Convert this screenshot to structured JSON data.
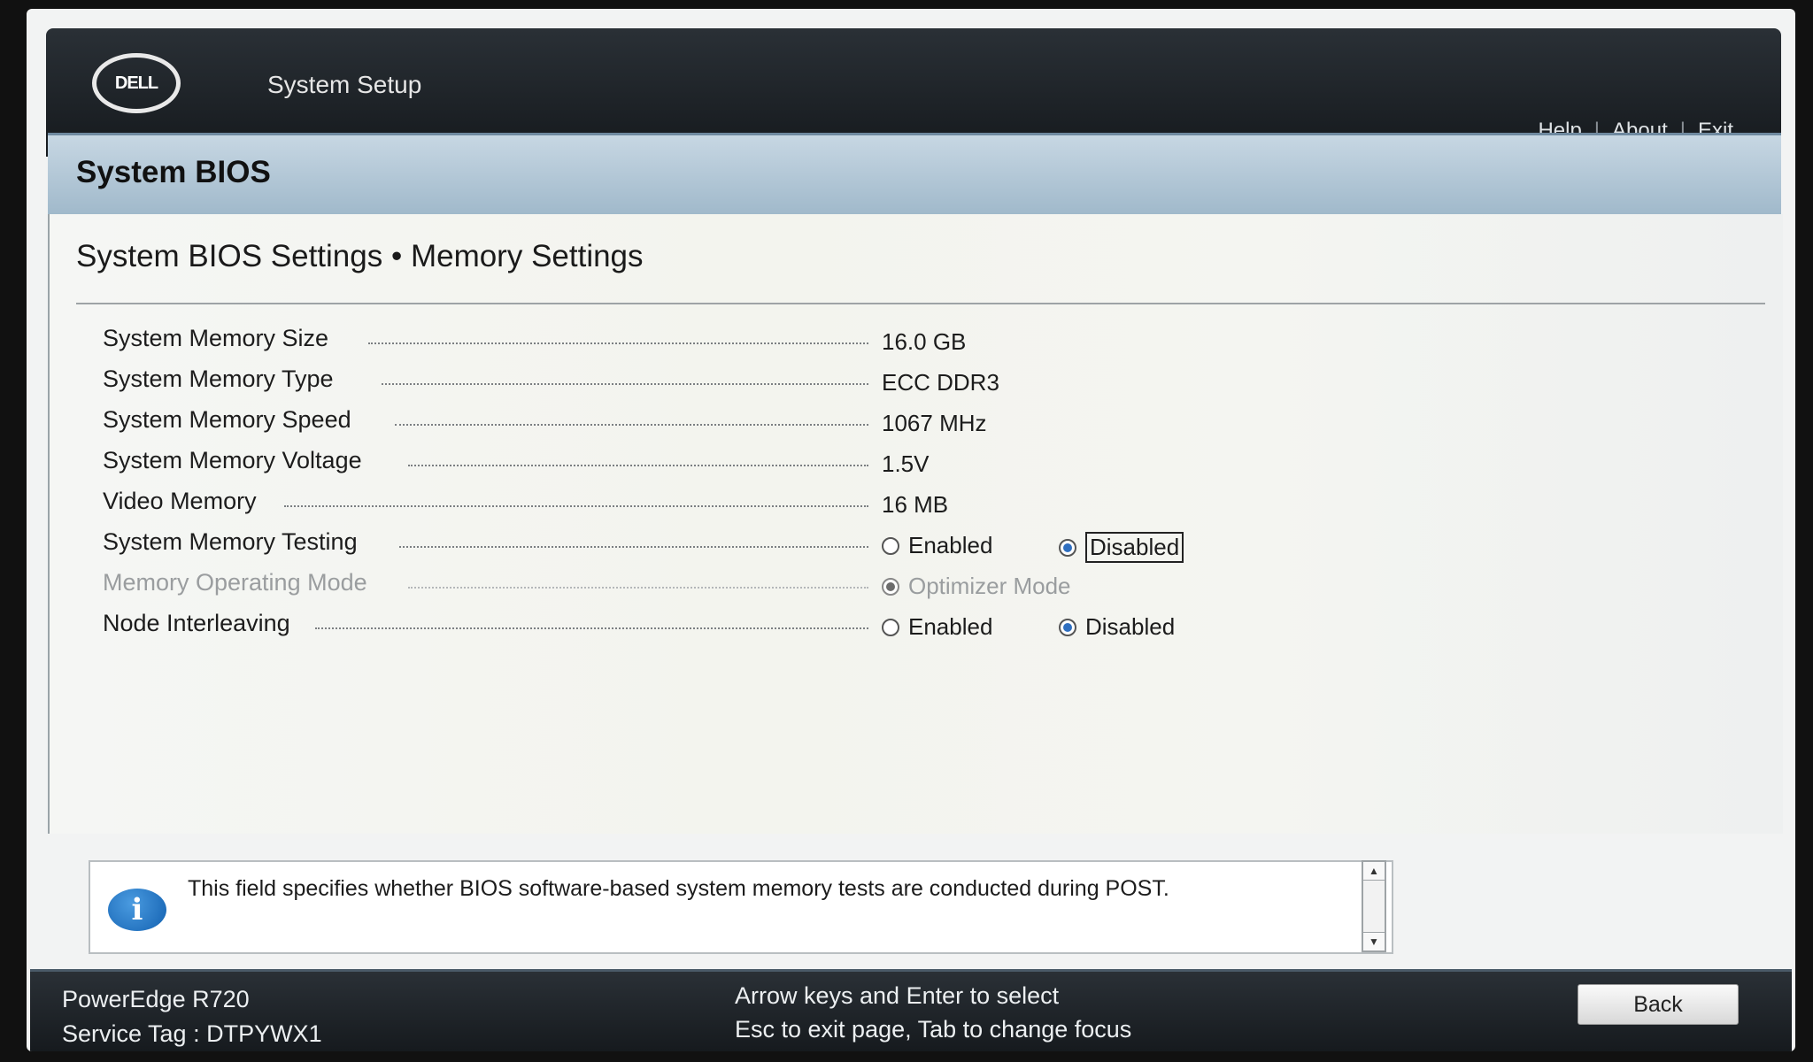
{
  "header": {
    "logo_text": "DELL",
    "app_title": "System Setup",
    "links": {
      "help": "Help",
      "about": "About",
      "exit": "Exit",
      "separator": "|"
    }
  },
  "banner": {
    "title": "System BIOS"
  },
  "page": {
    "title": "System BIOS Settings • Memory Settings",
    "rows": [
      {
        "label": "System Memory Size",
        "value": "16.0 GB"
      },
      {
        "label": "System Memory Type",
        "value": "ECC DDR3"
      },
      {
        "label": "System Memory Speed",
        "value": "1067 MHz"
      },
      {
        "label": "System Memory Voltage",
        "value": "1.5V"
      },
      {
        "label": "Video Memory",
        "value": "16 MB"
      },
      {
        "label": "System Memory Testing",
        "options": [
          "Enabled",
          "Disabled"
        ],
        "selected": "Disabled"
      },
      {
        "label": "Memory Operating Mode",
        "options": [
          "Optimizer Mode"
        ],
        "selected": "Optimizer Mode",
        "disabled": true
      },
      {
        "label": "Node Interleaving",
        "options": [
          "Enabled",
          "Disabled"
        ],
        "selected": "Disabled"
      }
    ]
  },
  "help": {
    "text": "This field specifies whether BIOS software-based system memory tests are conducted during POST."
  },
  "footer": {
    "model": "PowerEdge R720",
    "service_tag": "Service Tag : DTPYWX1",
    "hint_line1": "Arrow keys and Enter to select",
    "hint_line2": "Esc to exit page, Tab to change focus",
    "back_label": "Back"
  },
  "colors": {
    "header_bg": "#1b2025",
    "banner_bg": "#b3c8d7",
    "radio_selected": "#2f6fc0",
    "content_bg": "#f3f4f0"
  }
}
